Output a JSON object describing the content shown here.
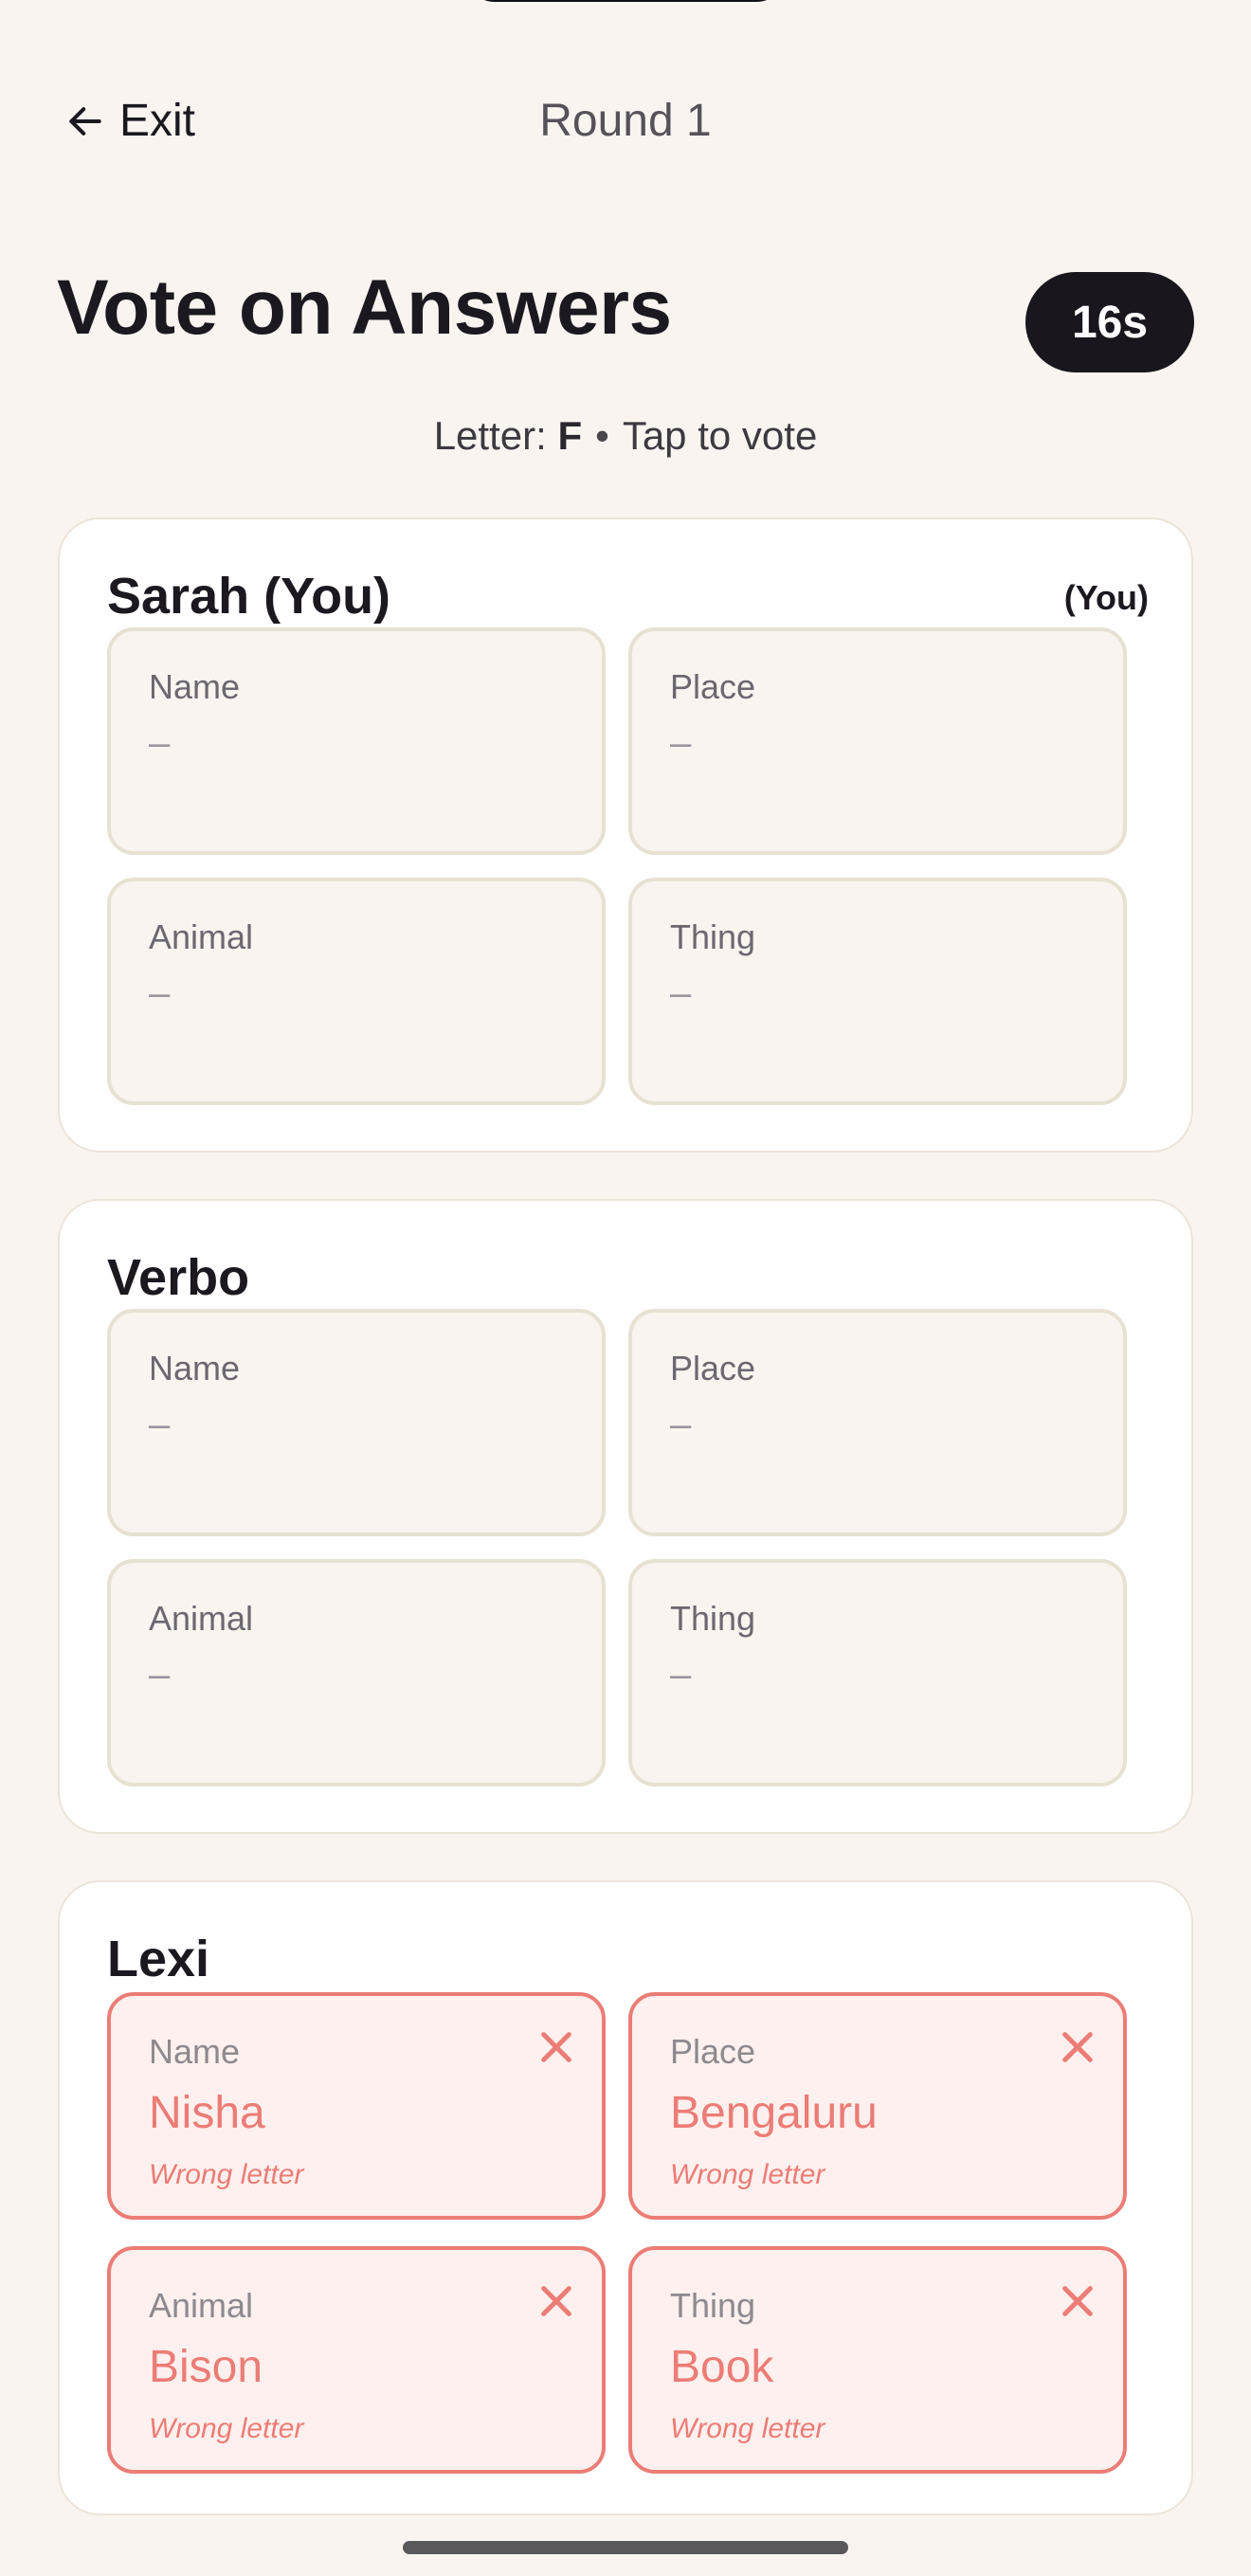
{
  "header": {
    "exit_label": "Exit",
    "round_label": "Round 1"
  },
  "title": "Vote on Answers",
  "timer": "16s",
  "subtitle": {
    "prefix": "Letter: ",
    "letter": "F",
    "separator": "•",
    "instruction": "Tap to vote"
  },
  "players": [
    {
      "name": "Sarah (You)",
      "tag": "(You)",
      "answers": [
        {
          "category": "Name",
          "value": "–"
        },
        {
          "category": "Place",
          "value": "–"
        },
        {
          "category": "Animal",
          "value": "–"
        },
        {
          "category": "Thing",
          "value": "–"
        }
      ]
    },
    {
      "name": "Verbo",
      "answers": [
        {
          "category": "Name",
          "value": "–"
        },
        {
          "category": "Place",
          "value": "–"
        },
        {
          "category": "Animal",
          "value": "–"
        },
        {
          "category": "Thing",
          "value": "–"
        }
      ]
    },
    {
      "name": "Lexi",
      "answers": [
        {
          "category": "Name",
          "value": "Nisha",
          "note": "Wrong letter"
        },
        {
          "category": "Place",
          "value": "Bengaluru",
          "note": "Wrong letter"
        },
        {
          "category": "Animal",
          "value": "Bison",
          "note": "Wrong letter"
        },
        {
          "category": "Thing",
          "value": "Book",
          "note": "Wrong letter"
        }
      ]
    }
  ],
  "colors": {
    "background": "#f9f4ef",
    "wrong_accent": "#ec7c76",
    "timer_bg": "#1a161d"
  },
  "icons": {
    "exit": "arrow-left-icon",
    "wrong": "x-mark-icon"
  }
}
